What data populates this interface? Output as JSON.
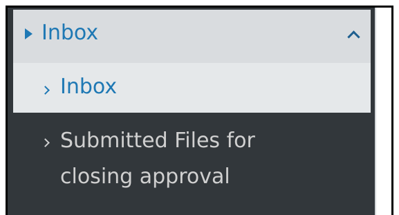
{
  "sidebar": {
    "section": {
      "label": "Inbox",
      "expanded": true,
      "icons": {
        "left": "caret-right-icon",
        "right": "chevron-up-icon"
      }
    },
    "items": [
      {
        "label": "Inbox",
        "active": true,
        "icon": "chevron-right-icon"
      },
      {
        "label": "Submitted Files for closing approval",
        "active": false,
        "icon": "chevron-right-icon"
      }
    ]
  },
  "colors": {
    "accent": "#1e78b4",
    "sidebar_bg": "#32373b",
    "section_bg": "#d9dcdf",
    "active_item_bg": "#e5e8ea",
    "inactive_text": "#d0d0d0"
  }
}
